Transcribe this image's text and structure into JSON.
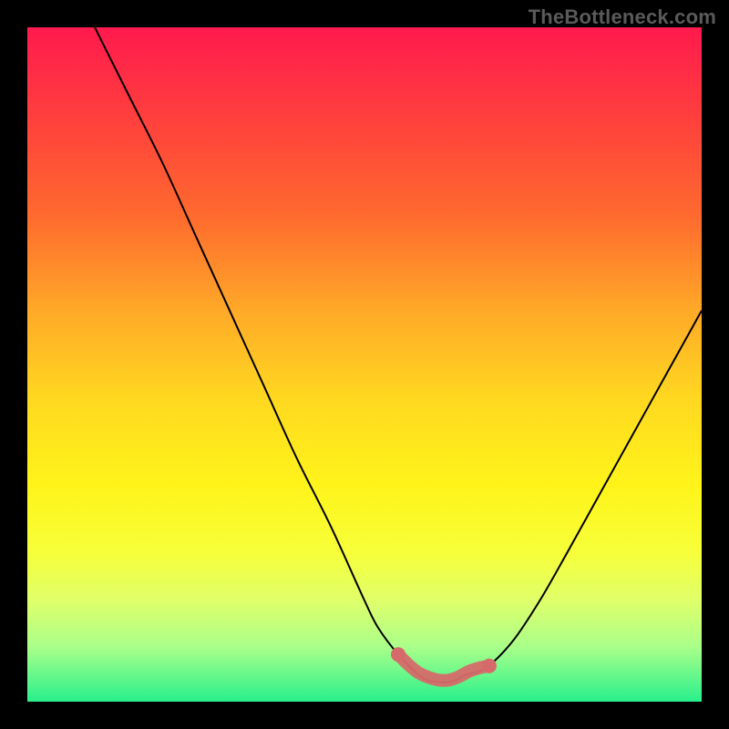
{
  "attribution": "TheBottleneck.com",
  "colors": {
    "frame": "#000000",
    "curve": "#000000",
    "marker": "#d66a6a",
    "gradient_stops": [
      "#ff1a4d",
      "#ff3b3f",
      "#ff6a2e",
      "#ffa928",
      "#ffd820",
      "#fff41a",
      "#f6ff3a",
      "#e0ff6a",
      "#a8ff8a",
      "#28f08c"
    ]
  },
  "chart_data": {
    "type": "line",
    "title": "",
    "xlabel": "",
    "ylabel": "",
    "xlim": [
      0,
      100
    ],
    "ylim": [
      0,
      100
    ],
    "grid": false,
    "series": [
      {
        "name": "bottleneck-curve",
        "x": [
          10,
          15,
          20,
          25,
          30,
          35,
          40,
          45,
          50,
          52,
          55,
          58,
          60,
          63,
          65,
          68,
          72,
          76,
          80,
          85,
          90,
          95,
          100
        ],
        "y": [
          100,
          90,
          80,
          69,
          58,
          47,
          36,
          26,
          15,
          11,
          7,
          4,
          3,
          3,
          4,
          5,
          9,
          15,
          22,
          31,
          40,
          49,
          58
        ]
      }
    ],
    "markers": {
      "name": "highlight-minimum",
      "x": [
        55,
        56.5,
        58,
        59.5,
        61,
        62.5,
        64,
        65.5,
        67,
        68.5
      ],
      "y": [
        7,
        5.5,
        4.3,
        3.6,
        3.2,
        3.2,
        3.7,
        4.5,
        5,
        5.3
      ]
    }
  }
}
